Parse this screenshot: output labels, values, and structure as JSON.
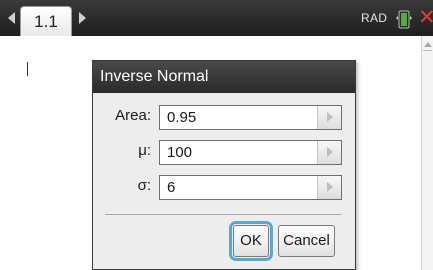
{
  "topbar": {
    "tab_label": "1.1",
    "angle_mode": "RAD",
    "icons": [
      "arrow-left-icon",
      "arrow-right-icon",
      "battery-icon",
      "close-icon"
    ],
    "close_glyph": "✕"
  },
  "dialog": {
    "title": "Inverse Normal",
    "fields": [
      {
        "label": "Area:",
        "value": "0.95"
      },
      {
        "label": "μ:",
        "value": "100"
      },
      {
        "label": "σ:",
        "value": "6"
      }
    ],
    "ok_label": "OK",
    "cancel_label": "Cancel"
  },
  "colors": {
    "focus": "#5aa6d6",
    "close": "#e03c31",
    "battery": "#4caf3c"
  }
}
